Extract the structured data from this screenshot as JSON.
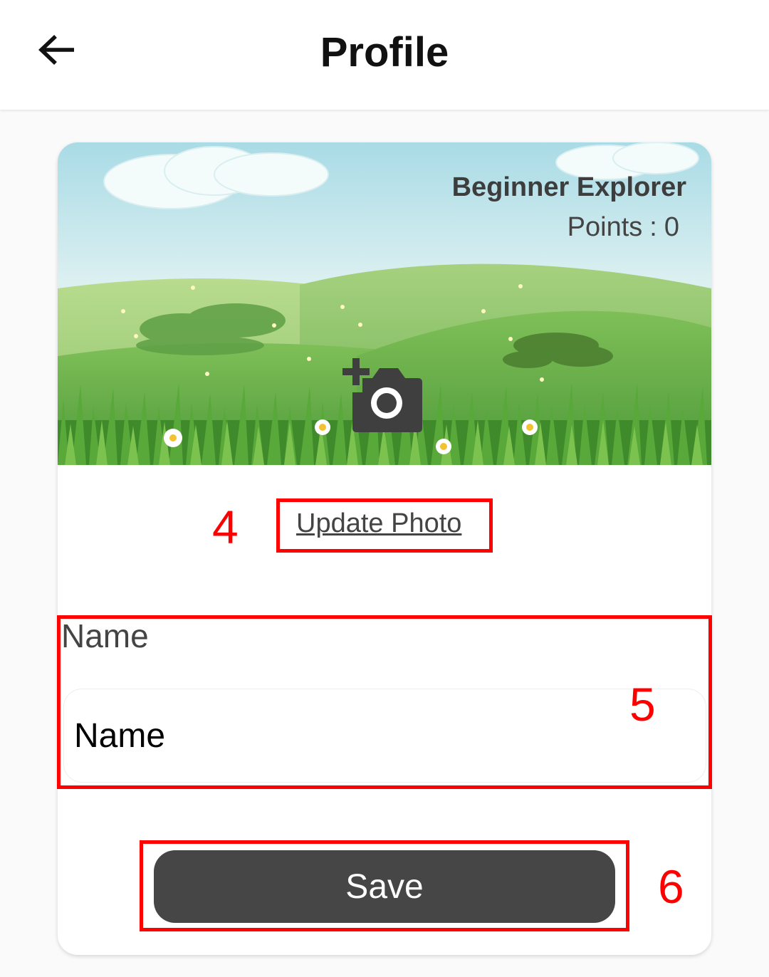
{
  "app_bar": {
    "title": "Profile",
    "back_icon": "arrow-left-icon"
  },
  "profile_card": {
    "level_title": "Beginner Explorer",
    "points_label": "Points",
    "points_separator": ":",
    "points_value": "0",
    "camera_icon": "add-photo-camera-icon",
    "update_photo_label": "Update Photo",
    "name_label": "Name",
    "name_input": {
      "value": "",
      "placeholder": "Name"
    },
    "save_label": "Save"
  },
  "annotations": [
    {
      "number": "4"
    },
    {
      "number": "5"
    },
    {
      "number": "6"
    }
  ],
  "colors": {
    "annotation": "#ff0000",
    "button": "#464646",
    "title": "#111111"
  }
}
